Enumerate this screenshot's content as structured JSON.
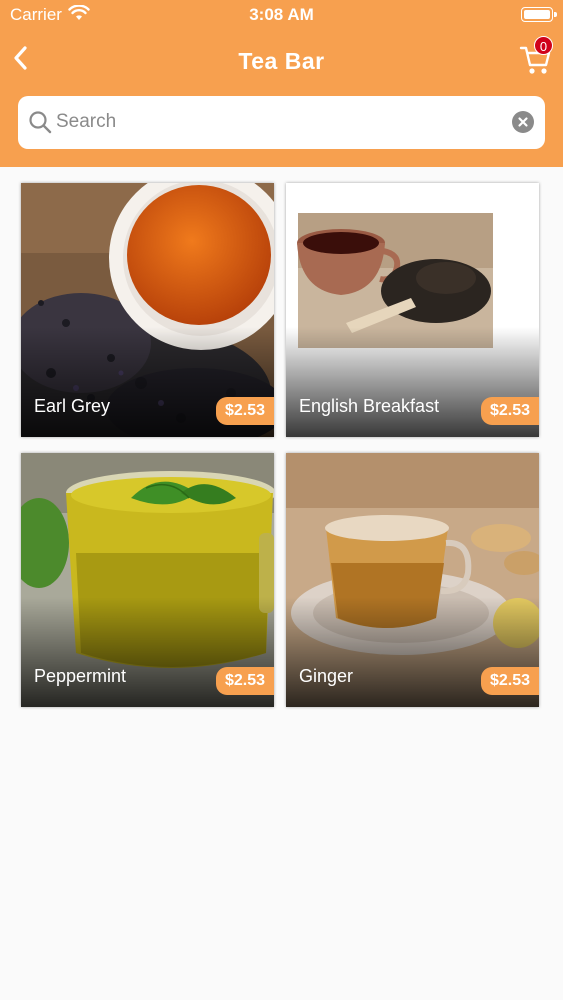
{
  "status_bar": {
    "carrier": "Carrier",
    "time": "3:08 AM"
  },
  "nav": {
    "title": "Tea Bar",
    "cart_count": "0"
  },
  "search": {
    "placeholder": "Search",
    "value": ""
  },
  "colors": {
    "accent": "#f7a04f",
    "badge": "#d0021b",
    "background": "#fafafa"
  },
  "icons": {
    "back": "chevron-left-icon",
    "cart": "cart-icon",
    "search": "magnifier-icon",
    "clear": "close-circle-icon",
    "wifi": "wifi-icon",
    "battery": "battery-icon"
  },
  "products": [
    {
      "name": "Earl Grey",
      "price": "$2.53"
    },
    {
      "name": "English Breakfast",
      "price": "$2.53"
    },
    {
      "name": "Peppermint",
      "price": "$2.53"
    },
    {
      "name": "Ginger",
      "price": "$2.53"
    }
  ]
}
